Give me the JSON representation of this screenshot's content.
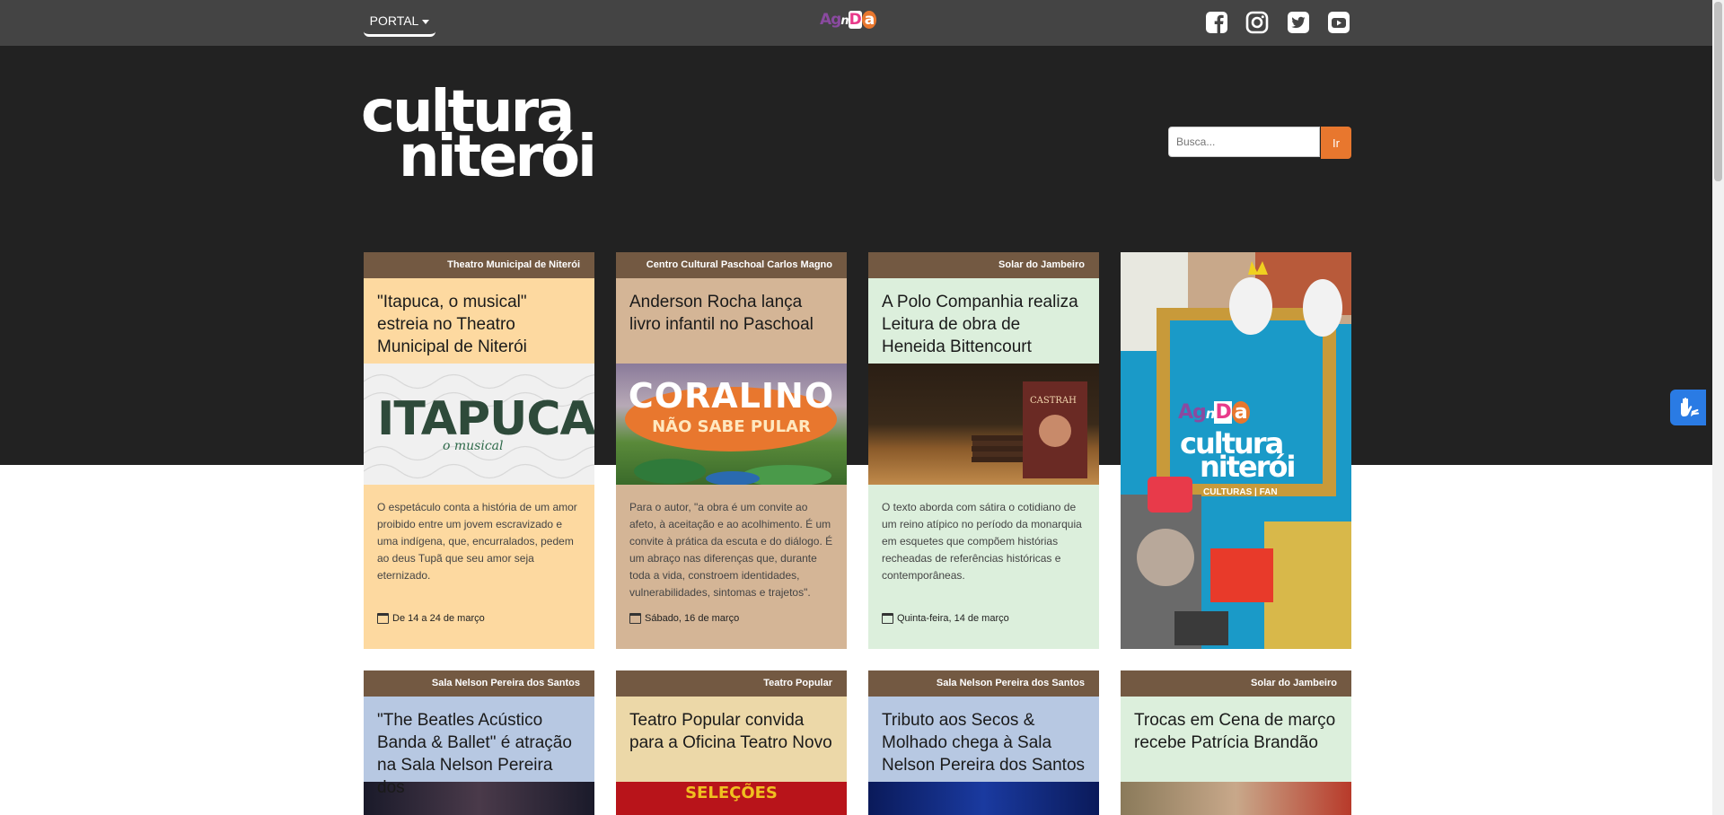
{
  "topbar": {
    "portal_label": "PORTAL",
    "agenda_logo": [
      "Ag",
      "n",
      "D",
      "a"
    ],
    "social": [
      "facebook-icon",
      "instagram-icon",
      "twitter-icon",
      "youtube-icon"
    ]
  },
  "logo": {
    "line1": "cultura",
    "line2": "niterói"
  },
  "search": {
    "placeholder": "Busca...",
    "button_label": "Ir"
  },
  "row1": [
    {
      "venue": "Theatro Municipal de Niterói",
      "title": "\"Itapuca, o musical\" estreia no Theatro Municipal de Niterói",
      "image_text": "ITAPUCA",
      "image_subtext": "o musical",
      "description": "O espetáculo conta a história de um amor proibido entre um jovem escravizado e uma indígena, que, encurralados, pedem ao deus Tupã que seu amor seja eternizado.",
      "date": "De 14 a 24 de março",
      "bg": "#fdd9a0"
    },
    {
      "venue": "Centro Cultural Paschoal Carlos Magno",
      "title": "Anderson Rocha lança livro infantil no Paschoal",
      "image_text": "CORALINO",
      "image_subtext": "NÃO SABE PULAR",
      "description": "Para o autor, \"a obra é um convite ao afeto, à aceitação e ao acolhimento. É um convite à prática da escuta e do diálogo. É um abraço nas diferenças que, durante toda a vida, constroem identidades, vulnerabilidades, sintomas e trajetos\".",
      "date": "Sábado, 16 de março",
      "bg": "#d4b596"
    },
    {
      "venue": "Solar do Jambeiro",
      "title": "A Polo Companhia realiza Leitura de obra de Heneida Bittencourt",
      "image_text": "CASTRAH",
      "image_subtext": "",
      "description": "O texto aborda com sátira o cotidiano de um reino atípico no período da monarquia em esquetes que compõem histórias recheadas de referências históricas e contemporâneas.",
      "date": "Quinta-feira, 14 de março",
      "bg": "#dcefdc"
    }
  ],
  "promo": {
    "agenda": [
      "Ag",
      "n",
      "D",
      "a"
    ],
    "line1": "cultura",
    "line2": "niterói",
    "tagline": "CULTURAS | FAN"
  },
  "row2": [
    {
      "venue": "Sala Nelson Pereira dos Santos",
      "title": "\"The Beatles Acústico Banda & Ballet\" é atração na Sala Nelson Pereira dos",
      "bg": "#b7c8e2",
      "image_text": ""
    },
    {
      "venue": "Teatro Popular",
      "title": "Teatro Popular convida para a Oficina Teatro Novo",
      "bg": "#ecd8a8",
      "image_text": "SELEÇÕES"
    },
    {
      "venue": "Sala Nelson Pereira dos Santos",
      "title": "Tributo aos Secos & Molhado chega à Sala Nelson Pereira dos Santos",
      "bg": "#b7c8e2",
      "image_text": ""
    },
    {
      "venue": "Solar do Jambeiro",
      "title": "Trocas em Cena de março recebe Patrícia Brandão",
      "bg": "#dcefdc",
      "image_text": ""
    }
  ],
  "colors": {
    "topbar": "#444444",
    "hero": "#222222",
    "venue_strip": "#735942",
    "search_button": "#e8772e",
    "accessibility": "#2a7be4"
  }
}
